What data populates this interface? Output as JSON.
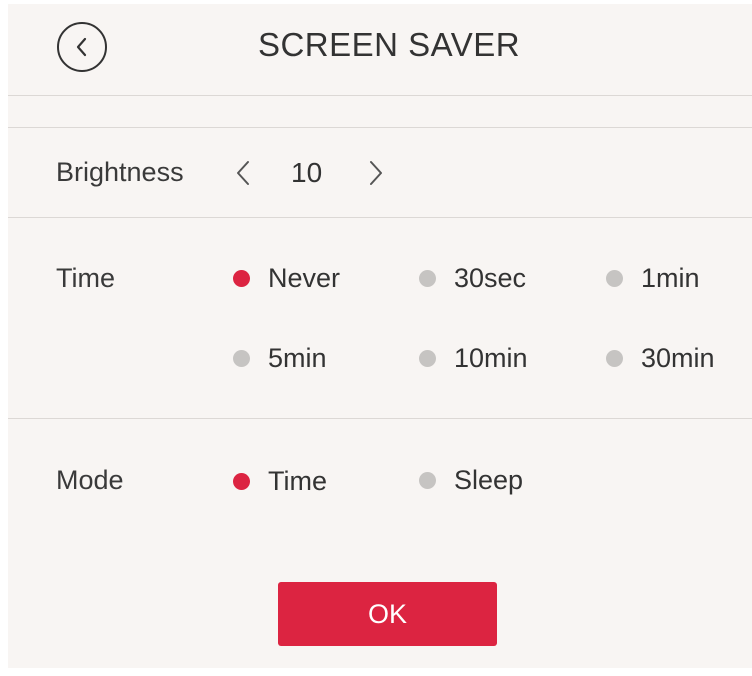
{
  "header": {
    "title": "SCREEN SAVER"
  },
  "brightness": {
    "label": "Brightness",
    "value": "10"
  },
  "time": {
    "label": "Time",
    "options": [
      {
        "label": "Never",
        "selected": true
      },
      {
        "label": "30sec",
        "selected": false
      },
      {
        "label": "1min",
        "selected": false
      },
      {
        "label": "5min",
        "selected": false
      },
      {
        "label": "10min",
        "selected": false
      },
      {
        "label": "30min",
        "selected": false
      }
    ]
  },
  "mode": {
    "label": "Mode",
    "options": [
      {
        "label": "Time",
        "selected": true
      },
      {
        "label": "Sleep",
        "selected": false
      }
    ]
  },
  "ok_label": "OK",
  "colors": {
    "accent": "#dc2441",
    "inactive_dot": "#c6c4c2",
    "background": "#f8f5f3"
  }
}
